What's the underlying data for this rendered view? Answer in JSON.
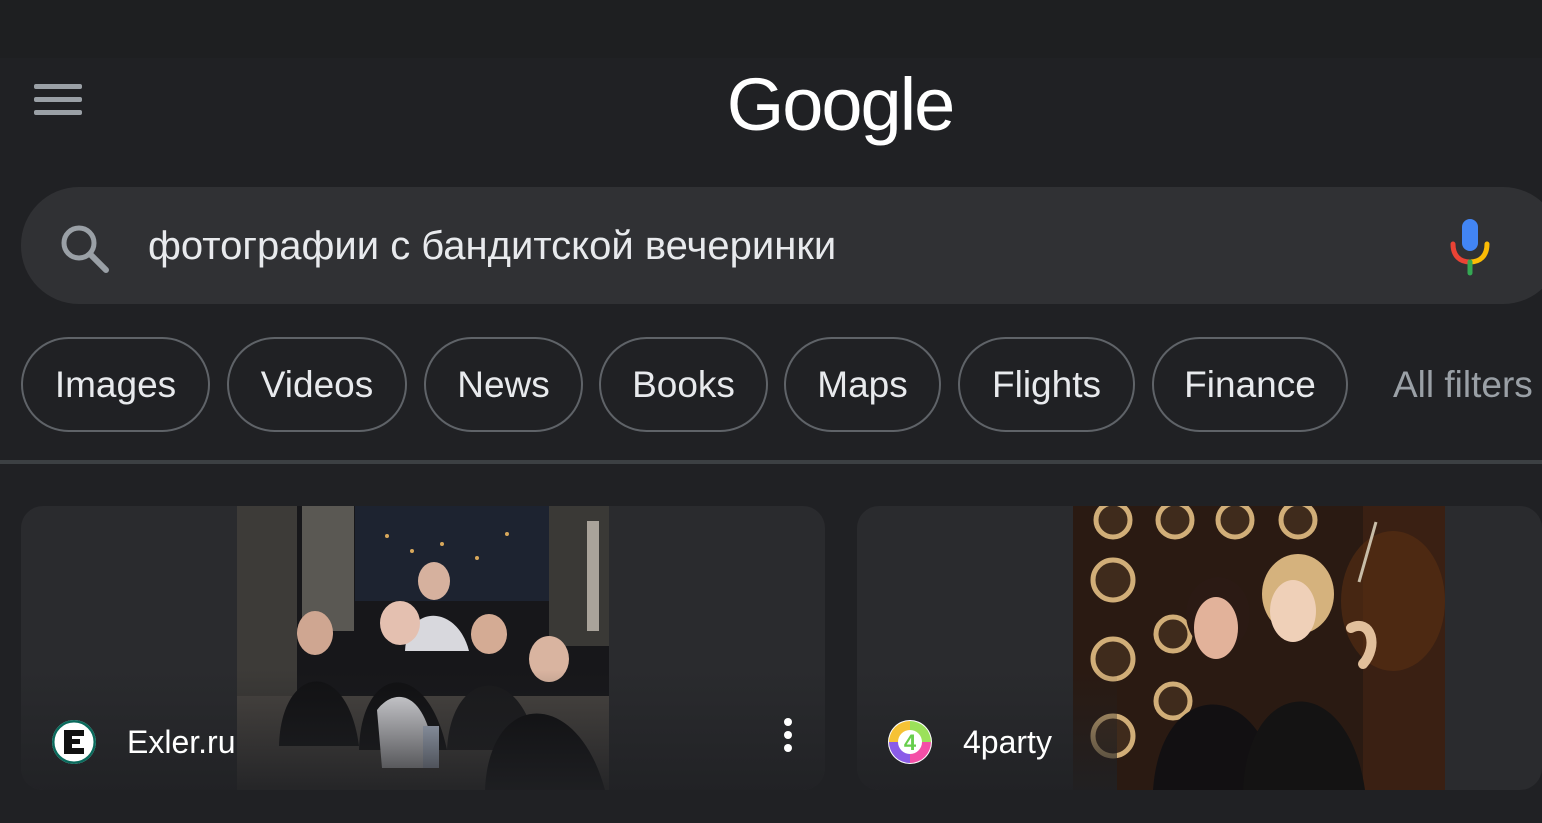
{
  "header": {
    "logo_text": "Google"
  },
  "search": {
    "query": "фотографии с бандитской вечеринки"
  },
  "chips": [
    {
      "label": "Images"
    },
    {
      "label": "Videos"
    },
    {
      "label": "News"
    },
    {
      "label": "Books"
    },
    {
      "label": "Maps"
    },
    {
      "label": "Flights"
    },
    {
      "label": "Finance"
    }
  ],
  "all_filters_label": "All filters",
  "results": [
    {
      "source": "Exler.ru",
      "favicon": "exler-favicon",
      "image": "group-photo-night-party"
    },
    {
      "source": "4party",
      "favicon": "4party-favicon",
      "image": "flapper-women-with-lights"
    }
  ],
  "colors": {
    "background": "#202124",
    "search_box": "#303134",
    "chip_border": "#5f6368",
    "mic_blue": "#4285f4",
    "mic_red": "#ea4335",
    "mic_yellow": "#fbbc05",
    "mic_green": "#34a853"
  }
}
